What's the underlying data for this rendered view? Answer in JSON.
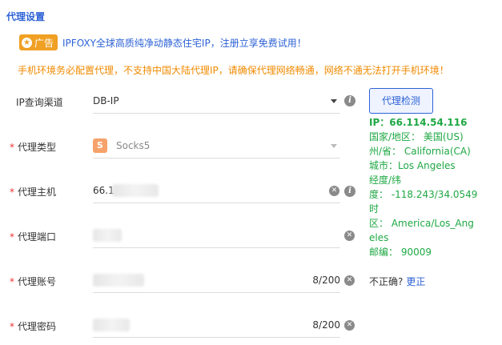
{
  "section_title": "代理设置",
  "ad": {
    "badge": "广告",
    "text": "IPFOXY全球高质纯净动静态住宅IP，注册立享免费试用！"
  },
  "warning": "手机环境务必配置代理，不支持中国大陆代理IP，请确保代理网络畅通，网络不通无法打开手机环境！",
  "form": {
    "ip_channel": {
      "label": "IP查询渠道",
      "value": "DB-IP"
    },
    "proxy_type": {
      "label": "代理类型",
      "value": "Socks5",
      "icon_letter": "S"
    },
    "proxy_host": {
      "label": "代理主机",
      "value": "66.1"
    },
    "proxy_port": {
      "label": "代理端口"
    },
    "proxy_account": {
      "label": "代理账号",
      "count": "8/200"
    },
    "proxy_password": {
      "label": "代理密码",
      "count": "8/200"
    }
  },
  "check_button": "代理检测",
  "result": {
    "ip": "IP：66.114.54.116",
    "country": "国家/地区： 美国(US)",
    "state": "州/省： California(CA)",
    "city": "城市：Los Angeles",
    "lonlat_label": "经度/纬",
    "lonlat_value": "度： -118.243/34.0549",
    "tz_label": "时",
    "tz_value": "区： America/Los_Ang",
    "tz_value2": "eles",
    "zip": "邮编： 90009"
  },
  "correction": {
    "question": "不正确?",
    "link": "更正"
  },
  "colors": {
    "accent": "#2d62d6",
    "warning": "#f08a00",
    "success": "#1fa844",
    "badge": "#f0a023"
  }
}
